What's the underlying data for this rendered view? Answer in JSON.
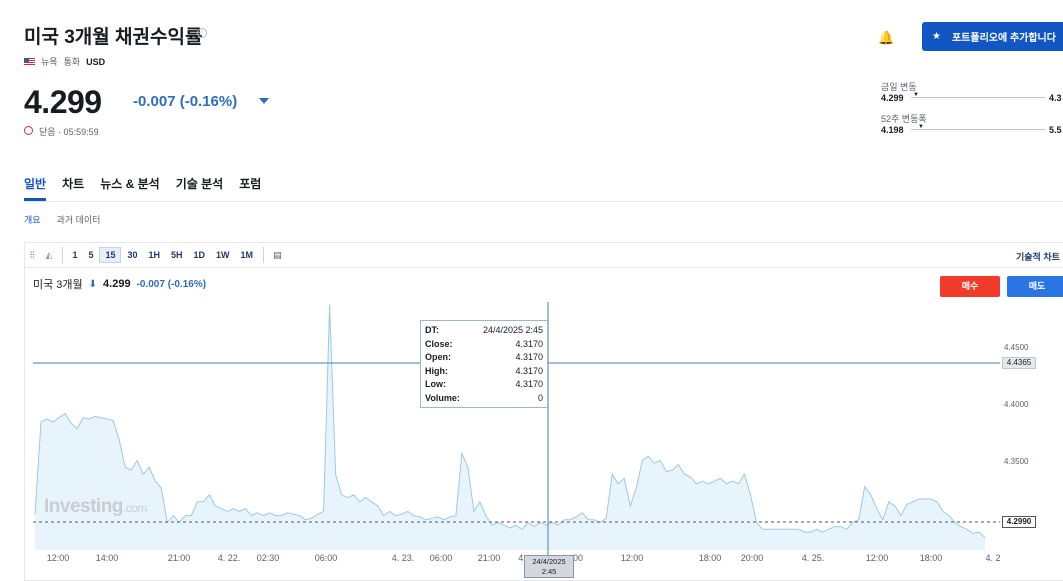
{
  "header": {
    "title": "미국 3개월 채권수익률",
    "info_icon": "info-icon",
    "exchange": "뉴욕",
    "currency_label": "통화",
    "currency": "USD",
    "price": "4.299",
    "change": "-0.007",
    "change_pct": "(-0.16%)",
    "status": "닫음 · 05:59:59",
    "portfolio_button": "포트폴리오에 추가합니다",
    "colors": {
      "down": "#2a6ebd",
      "primary": "#1256c4",
      "buy": "#f23b2a",
      "sell": "#2a75e4"
    }
  },
  "ranges": {
    "day_label": "금일 변동",
    "day_low": "4.299",
    "day_high": "4.3",
    "week52_label": "52주 변동폭",
    "week52_low": "4.198",
    "week52_high": "5.5"
  },
  "tabs": [
    "일반",
    "차트",
    "뉴스 & 분석",
    "기술 분석",
    "포럼"
  ],
  "subtabs": [
    "개요",
    "과거 데이터"
  ],
  "toolbar": {
    "intervals": [
      "1",
      "5",
      "15",
      "30",
      "1H",
      "5H",
      "1D",
      "1W",
      "1M"
    ],
    "active_interval": "15",
    "technical_chart": "기술적 차트"
  },
  "chart_header": {
    "name": "미국 3개월",
    "arrow": "⬇",
    "value": "4.299",
    "change": "-0.007 (-0.16%)",
    "buy_button": "매수",
    "sell_button": "매도"
  },
  "tooltip": {
    "dt_label": "DT:",
    "dt": "24/4/2025 2:45",
    "close_label": "Close:",
    "close": "4.3170",
    "open_label": "Open:",
    "open": "4.3170",
    "high_label": "High:",
    "high": "4.3170",
    "low_label": "Low:",
    "low": "4.3170",
    "volume_label": "Volume:",
    "volume": "0"
  },
  "watermark": {
    "brand": "Investing",
    "suffix": ".com"
  },
  "crosshair": {
    "x_label_date": "24/4/2025",
    "x_label_time": "2:45",
    "y_value": "4.4365"
  },
  "chart_data": {
    "type": "area",
    "x_ticks": [
      "12:00",
      "14:00",
      "21:00",
      "4. 22.",
      "02:30",
      "06:00",
      "4. 23.",
      "06:00",
      "21:00",
      "4.",
      "00",
      "12:00",
      "18:00",
      "20:00",
      "4. 25.",
      "12:00",
      "18:00",
      "4. 2"
    ],
    "y_ticks": [
      "4.4500",
      "4.4000",
      "4.3500"
    ],
    "ylim": [
      4.29,
      4.47
    ],
    "last_value": "4.2990",
    "values": [
      4.316,
      4.383,
      4.385,
      4.383,
      4.386,
      4.389,
      4.382,
      4.378,
      4.386,
      4.385,
      4.387,
      4.386,
      4.385,
      4.384,
      4.37,
      4.35,
      4.348,
      4.355,
      4.345,
      4.35,
      4.34,
      4.335,
      4.31,
      4.315,
      4.31,
      4.315,
      4.315,
      4.325,
      4.325,
      4.33,
      4.322,
      4.32,
      4.318,
      4.32,
      4.318,
      4.32,
      4.315,
      4.317,
      4.315,
      4.317,
      4.315,
      4.315,
      4.317,
      4.316,
      4.315,
      4.312,
      4.313,
      4.316,
      4.318,
      4.468,
      4.345,
      4.33,
      4.328,
      4.33,
      4.325,
      4.328,
      4.325,
      4.322,
      4.315,
      4.318,
      4.315,
      4.316,
      4.318,
      4.315,
      4.314,
      4.312,
      4.313,
      4.314,
      4.312,
      4.314,
      4.315,
      4.36,
      4.35,
      4.318,
      4.325,
      4.315,
      4.308,
      4.31,
      4.308,
      4.306,
      4.308,
      4.305,
      4.31,
      4.307,
      4.31,
      4.308,
      4.31,
      4.308,
      4.312,
      4.312,
      4.314,
      4.317,
      4.312,
      4.312,
      4.31,
      4.313,
      4.345,
      4.338,
      4.342,
      4.322,
      4.335,
      4.355,
      4.358,
      4.353,
      4.355,
      4.347,
      4.348,
      4.352,
      4.345,
      4.343,
      4.338,
      4.34,
      4.338,
      4.34,
      4.342,
      4.338,
      4.34,
      4.338,
      4.345,
      4.33,
      4.31,
      4.305,
      4.305,
      4.305,
      4.305,
      4.305,
      4.305,
      4.305,
      4.303,
      4.303,
      4.305,
      4.303,
      4.305,
      4.307,
      4.307,
      4.305,
      4.31,
      4.312,
      4.336,
      4.33,
      4.32,
      4.312,
      4.325,
      4.322,
      4.315,
      4.323,
      4.325,
      4.327,
      4.327,
      4.327,
      4.325,
      4.318,
      4.315,
      4.31,
      4.307,
      4.305,
      4.302,
      4.303,
      4.299
    ]
  }
}
